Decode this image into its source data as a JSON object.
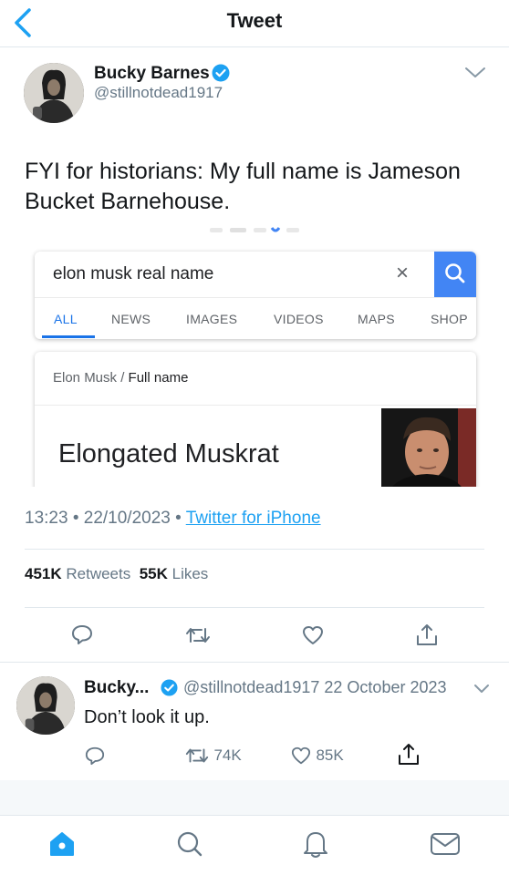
{
  "header": {
    "title": "Tweet"
  },
  "tweet": {
    "author_name": "Bucky Barnes",
    "author_handle": "@stillnotdead1917",
    "text": "FYI for historians: My full name is Jameson Bucket Barnehouse.",
    "embed": {
      "query": "elon musk real name",
      "tabs": [
        "ALL",
        "NEWS",
        "IMAGES",
        "VIDEOS",
        "MAPS",
        "SHOP"
      ],
      "breadcrumb_subject": "Elon Musk",
      "breadcrumb_sep": "/",
      "breadcrumb_attr": "Full name",
      "answer": "Elongated Muskrat"
    },
    "time": "13:23",
    "date": "22/10/2023",
    "dot": "•",
    "client": "Twitter for iPhone",
    "retweets": "451K",
    "retweets_label": "Retweets",
    "likes": "55K",
    "likes_label": "Likes"
  },
  "reply": {
    "author_name": "Bucky...",
    "author_handle": "@stillnotdead1917",
    "date": "22 October 2023",
    "text": "Don’t look it up.",
    "retweets": "74K",
    "likes": "85K"
  },
  "colors": {
    "accent": "#1da1f2",
    "muted": "#657786",
    "divider": "#e1e8ed",
    "google_blue": "#4285f4"
  },
  "icons": [
    "back-chevron-icon",
    "verified-icon",
    "more-chevron-icon",
    "reply-icon",
    "retweet-icon",
    "like-icon",
    "share-icon",
    "home-icon",
    "search-icon",
    "notifications-icon",
    "messages-icon"
  ]
}
